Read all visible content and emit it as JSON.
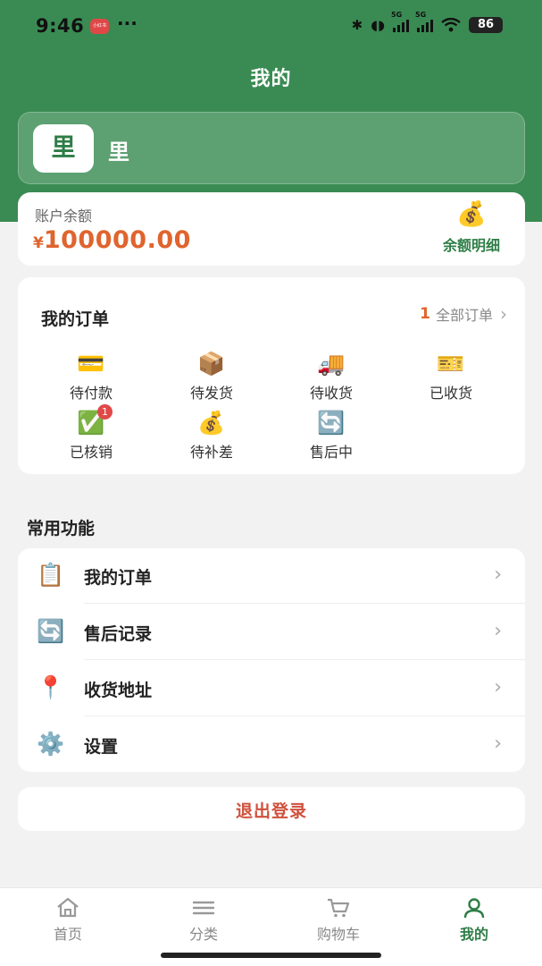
{
  "status_bar": {
    "time": "9:46",
    "app_badge": "小红书",
    "dots": "···",
    "network_1": "5G",
    "network_2": "5G",
    "battery": "86"
  },
  "header": {
    "title": "我的"
  },
  "user": {
    "avatar_char": "里",
    "name": "里"
  },
  "balance": {
    "label": "账户余额",
    "currency": "¥",
    "amount": "100000.00",
    "detail_icon": "💰",
    "detail_label": "余额明细"
  },
  "orders": {
    "title": "我的订单",
    "count": "1",
    "all_label": "全部订单",
    "chevron": "›",
    "items": [
      {
        "icon": "💳",
        "label": "待付款"
      },
      {
        "icon": "📦",
        "label": "待发货"
      },
      {
        "icon": "🚚",
        "label": "待收货"
      },
      {
        "icon": "🎫",
        "label": "已收货"
      },
      {
        "icon": "✅",
        "label": "已核销",
        "badge": "1"
      },
      {
        "icon": "💰",
        "label": "待补差"
      },
      {
        "icon": "🔄",
        "label": "售后中"
      }
    ]
  },
  "common": {
    "title": "常用功能",
    "items": [
      {
        "icon": "📋",
        "label": "我的订单"
      },
      {
        "icon": "🔄",
        "label": "售后记录"
      },
      {
        "icon": "📍",
        "label": "收货地址"
      },
      {
        "icon": "⚙️",
        "label": "设置"
      }
    ],
    "chevron": "›"
  },
  "logout": {
    "label": "退出登录"
  },
  "tabbar": {
    "items": [
      {
        "icon": "home-icon",
        "label": "首页"
      },
      {
        "icon": "menu-icon",
        "label": "分类"
      },
      {
        "icon": "cart-icon",
        "label": "购物车"
      },
      {
        "icon": "user-icon",
        "label": "我的",
        "active": true
      }
    ]
  },
  "colors": {
    "brand_green": "#3a8b53",
    "accent_orange": "#e0642e",
    "logout_red": "#d0503c"
  }
}
